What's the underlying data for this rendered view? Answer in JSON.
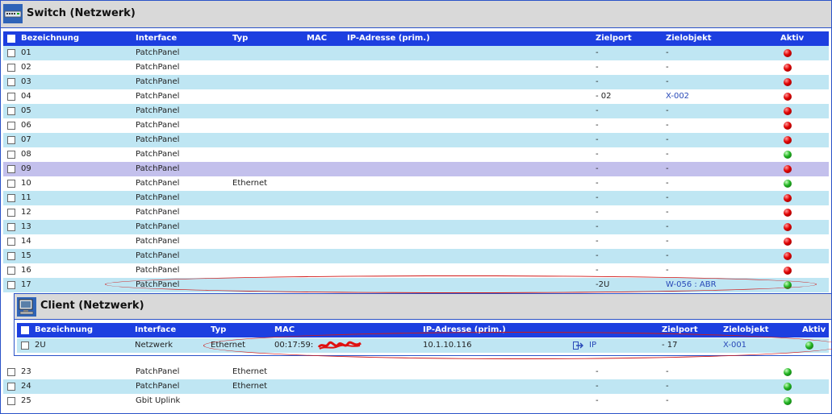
{
  "switch": {
    "title": "Switch (Netzwerk)",
    "columns": {
      "bezeichnung": "Bezeichnung",
      "interface": "Interface",
      "typ": "Typ",
      "mac": "MAC",
      "ip": "IP-Adresse (prim.)",
      "zielport": "Zielport",
      "zielobjekt": "Zielobjekt",
      "aktiv": "Aktiv"
    },
    "rows": [
      {
        "name": "01",
        "interface": "PatchPanel",
        "typ": "",
        "zielport": "-",
        "zielobjekt": "-",
        "aktiv": "red"
      },
      {
        "name": "02",
        "interface": "PatchPanel",
        "typ": "",
        "zielport": "-",
        "zielobjekt": "-",
        "aktiv": "red"
      },
      {
        "name": "03",
        "interface": "PatchPanel",
        "typ": "",
        "zielport": "-",
        "zielobjekt": "-",
        "aktiv": "red"
      },
      {
        "name": "04",
        "interface": "PatchPanel",
        "typ": "",
        "zielport": "- 02",
        "zielobjekt": "X-002",
        "aktiv": "red"
      },
      {
        "name": "05",
        "interface": "PatchPanel",
        "typ": "",
        "zielport": "-",
        "zielobjekt": "-",
        "aktiv": "red"
      },
      {
        "name": "06",
        "interface": "PatchPanel",
        "typ": "",
        "zielport": "-",
        "zielobjekt": "-",
        "aktiv": "red"
      },
      {
        "name": "07",
        "interface": "PatchPanel",
        "typ": "",
        "zielport": "-",
        "zielobjekt": "-",
        "aktiv": "red"
      },
      {
        "name": "08",
        "interface": "PatchPanel",
        "typ": "",
        "zielport": "-",
        "zielobjekt": "-",
        "aktiv": "green"
      },
      {
        "name": "09",
        "interface": "PatchPanel",
        "typ": "",
        "zielport": "-",
        "zielobjekt": "-",
        "aktiv": "red"
      },
      {
        "name": "10",
        "interface": "PatchPanel",
        "typ": "Ethernet",
        "zielport": "-",
        "zielobjekt": "-",
        "aktiv": "green"
      },
      {
        "name": "11",
        "interface": "PatchPanel",
        "typ": "",
        "zielport": "-",
        "zielobjekt": "-",
        "aktiv": "red"
      },
      {
        "name": "12",
        "interface": "PatchPanel",
        "typ": "",
        "zielport": "-",
        "zielobjekt": "-",
        "aktiv": "red"
      },
      {
        "name": "13",
        "interface": "PatchPanel",
        "typ": "",
        "zielport": "-",
        "zielobjekt": "-",
        "aktiv": "red"
      },
      {
        "name": "14",
        "interface": "PatchPanel",
        "typ": "",
        "zielport": "-",
        "zielobjekt": "-",
        "aktiv": "red"
      },
      {
        "name": "15",
        "interface": "PatchPanel",
        "typ": "",
        "zielport": "-",
        "zielobjekt": "-",
        "aktiv": "red"
      },
      {
        "name": "16",
        "interface": "PatchPanel",
        "typ": "",
        "zielport": "-",
        "zielobjekt": "-",
        "aktiv": "red"
      },
      {
        "name": "17",
        "interface": "PatchPanel",
        "typ": "",
        "zielport": "-2U",
        "zielobjekt": "W-056 : ABR",
        "aktiv": "green"
      },
      {
        "name": "23",
        "interface": "PatchPanel",
        "typ": "Ethernet",
        "zielport": "-",
        "zielobjekt": "-",
        "aktiv": "green"
      },
      {
        "name": "24",
        "interface": "PatchPanel",
        "typ": "Ethernet",
        "zielport": "-",
        "zielobjekt": "-",
        "aktiv": "green"
      },
      {
        "name": "25",
        "interface": "Gbit Uplink",
        "typ": "",
        "zielport": "-",
        "zielobjekt": "-",
        "aktiv": "green"
      }
    ]
  },
  "client": {
    "title": "Client (Netzwerk)",
    "columns": {
      "bezeichnung": "Bezeichnung",
      "interface": "Interface",
      "typ": "Typ",
      "mac": "MAC",
      "ip": "IP-Adresse (prim.)",
      "zielport": "Zielport",
      "zielobjekt": "Zielobjekt",
      "aktiv": "Aktiv"
    },
    "row": {
      "name": "2U",
      "interface": "Netzwerk",
      "typ": "Ethernet",
      "mac": "00:17:59:",
      "ip": "10.1.10.116",
      "ip_link": "IP",
      "zielport": "- 17",
      "zielobjekt": "X-001",
      "aktiv": "green"
    }
  },
  "colors": {
    "header_bg": "#1d3fe0",
    "row_light": "#bfe6f3",
    "row_white": "#ffffff",
    "row_highlight": "#c3c0ec",
    "status_red": "#e00000",
    "status_green": "#22b422",
    "annotation": "#d01818"
  }
}
